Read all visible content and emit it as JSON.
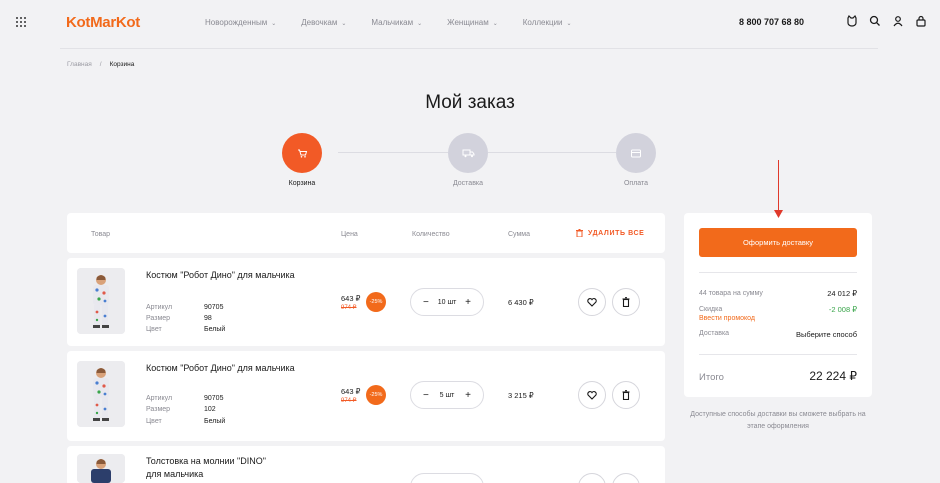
{
  "header": {
    "logo": "KotMarKot",
    "nav": [
      {
        "label": "Новорожденным"
      },
      {
        "label": "Девочкам"
      },
      {
        "label": "Мальчикам"
      },
      {
        "label": "Женщинам"
      },
      {
        "label": "Коллекции"
      }
    ],
    "chevron": "⌄",
    "phone": "8 800 707 68 80",
    "icons": [
      "cat-icon",
      "search-icon",
      "user-icon",
      "bag-icon"
    ]
  },
  "breadcrumb": {
    "home": "Главная",
    "separator": "/",
    "current": "Корзина"
  },
  "page_title": "Мой заказ",
  "steps": [
    {
      "label": "Корзина",
      "active": true
    },
    {
      "label": "Доставка",
      "active": false
    },
    {
      "label": "Оплата",
      "active": false
    }
  ],
  "table": {
    "headers": {
      "product": "Товар",
      "price": "Цена",
      "qty": "Количество",
      "sum": "Сумма"
    },
    "delete_all": "УДАЛИТЬ ВСЕ"
  },
  "attr_labels": {
    "article": "Артикул",
    "size": "Размер",
    "color": "Цвет"
  },
  "items": [
    {
      "name": "Костюм \"Робот Дино\" для мальчика",
      "article": "90705",
      "size": "98",
      "color": "Белый",
      "price": "643 ₽",
      "old_price": "974 ₽",
      "discount": "-25%",
      "qty": "10 шт",
      "sum": "6 430 ₽"
    },
    {
      "name": "Костюм \"Робот Дино\" для мальчика",
      "article": "90705",
      "size": "102",
      "color": "Белый",
      "price": "643 ₽",
      "old_price": "974 ₽",
      "discount": "-25%",
      "qty": "5 шт",
      "sum": "3 215 ₽"
    },
    {
      "name_line1": "Толстовка на молнии \"DINO\"",
      "name_line2": "для мальчика"
    }
  ],
  "summary": {
    "checkout": "Оформить доставку",
    "items_label": "44 товара на сумму",
    "items_value": "24 012 ₽",
    "discount_label": "Скидка",
    "discount_value": "-2 008 ₽",
    "promo": "Ввести промокод",
    "delivery_label": "Доставка",
    "delivery_value": "Выберите способ",
    "total_label": "Итого",
    "total_value": "22 224 ₽",
    "note": "Доступные способы доставки вы сможете выбрать на этапе оформления"
  },
  "colors": {
    "accent": "#f26a1b",
    "discount_green": "#3aa54b",
    "arrow": "#e0392b",
    "bg": "#f2f2f4"
  }
}
